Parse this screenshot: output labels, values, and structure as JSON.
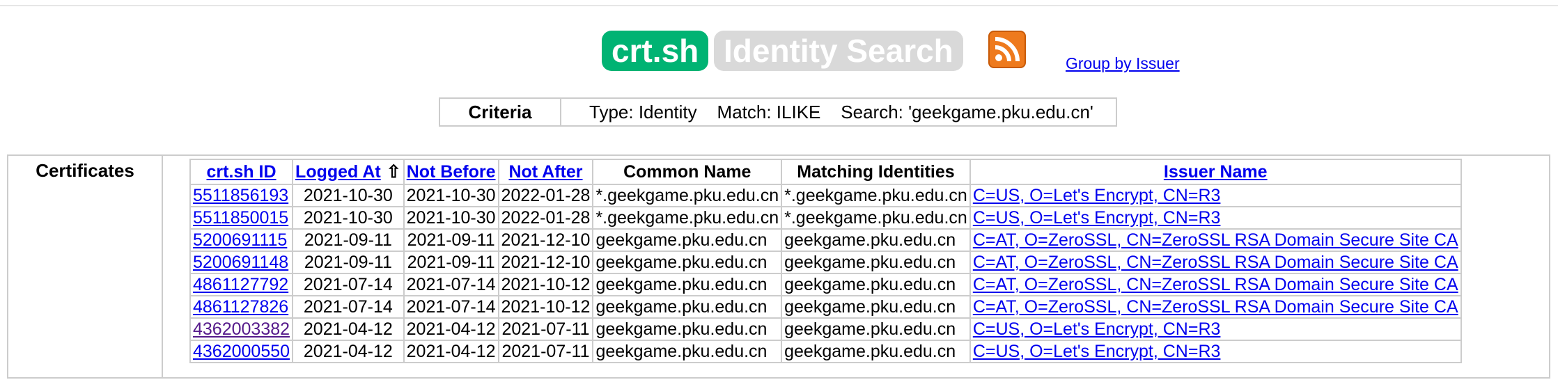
{
  "header": {
    "logo": "crt.sh",
    "subtitle": "Identity Search",
    "rss_icon": "rss-feed-icon",
    "group_by_issuer": "Group by Issuer"
  },
  "criteria": {
    "label": "Criteria",
    "values": "Type: Identity    Match: ILIKE    Search: 'geekgame.pku.edu.cn'"
  },
  "certificates": {
    "label": "Certificates",
    "columns": {
      "id": "crt.sh ID",
      "logged_at": "Logged At",
      "sort_arrow": "⇧",
      "not_before": "Not Before",
      "not_after": "Not After",
      "common_name": "Common Name",
      "matching_identities": "Matching Identities",
      "issuer_name": "Issuer Name"
    },
    "rows": [
      {
        "id": "5511856193",
        "logged_at": "2021-10-30",
        "not_before": "2021-10-30",
        "not_after": "2022-01-28",
        "common_name": "*.geekgame.pku.edu.cn",
        "matching": "*.geekgame.pku.edu.cn",
        "issuer": "C=US, O=Let's Encrypt, CN=R3"
      },
      {
        "id": "5511850015",
        "logged_at": "2021-10-30",
        "not_before": "2021-10-30",
        "not_after": "2022-01-28",
        "common_name": "*.geekgame.pku.edu.cn",
        "matching": "*.geekgame.pku.edu.cn",
        "issuer": "C=US, O=Let's Encrypt, CN=R3"
      },
      {
        "id": "5200691115",
        "logged_at": "2021-09-11",
        "not_before": "2021-09-11",
        "not_after": "2021-12-10",
        "common_name": "geekgame.pku.edu.cn",
        "matching": "geekgame.pku.edu.cn",
        "issuer": "C=AT, O=ZeroSSL, CN=ZeroSSL RSA Domain Secure Site CA"
      },
      {
        "id": "5200691148",
        "logged_at": "2021-09-11",
        "not_before": "2021-09-11",
        "not_after": "2021-12-10",
        "common_name": "geekgame.pku.edu.cn",
        "matching": "geekgame.pku.edu.cn",
        "issuer": "C=AT, O=ZeroSSL, CN=ZeroSSL RSA Domain Secure Site CA"
      },
      {
        "id": "4861127792",
        "logged_at": "2021-07-14",
        "not_before": "2021-07-14",
        "not_after": "2021-10-12",
        "common_name": "geekgame.pku.edu.cn",
        "matching": "geekgame.pku.edu.cn",
        "issuer": "C=AT, O=ZeroSSL, CN=ZeroSSL RSA Domain Secure Site CA"
      },
      {
        "id": "4861127826",
        "logged_at": "2021-07-14",
        "not_before": "2021-07-14",
        "not_after": "2021-10-12",
        "common_name": "geekgame.pku.edu.cn",
        "matching": "geekgame.pku.edu.cn",
        "issuer": "C=AT, O=ZeroSSL, CN=ZeroSSL RSA Domain Secure Site CA"
      },
      {
        "id": "4362003382",
        "logged_at": "2021-04-12",
        "not_before": "2021-04-12",
        "not_after": "2021-07-11",
        "common_name": "geekgame.pku.edu.cn",
        "matching": "geekgame.pku.edu.cn",
        "issuer": "C=US, O=Let's Encrypt, CN=R3",
        "visited": true
      },
      {
        "id": "4362000550",
        "logged_at": "2021-04-12",
        "not_before": "2021-04-12",
        "not_after": "2021-07-11",
        "common_name": "geekgame.pku.edu.cn",
        "matching": "geekgame.pku.edu.cn",
        "issuer": "C=US, O=Let's Encrypt, CN=R3"
      }
    ]
  },
  "colors": {
    "logo_bg": "#00b373",
    "subtitle_bg": "#d9d9d9",
    "rss_orange": "#ee7a1d",
    "link": "#0000ee",
    "visited_link": "#551a8b",
    "border": "#cccccc"
  }
}
